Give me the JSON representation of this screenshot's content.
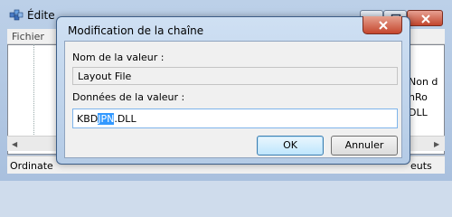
{
  "background_window": {
    "title": "Édite",
    "menu": [
      "Fichier"
    ],
    "right_column_lines": [
      "Non d",
      "nRo",
      "DLL"
    ],
    "status_left": "Ordinate",
    "status_right": "euts"
  },
  "dialog": {
    "title": "Modification de la chaîne",
    "value_name_label": "Nom de la valeur :",
    "value_name": "Layout File",
    "value_data_label": "Données de la valeur :",
    "value_data_before": "KBD",
    "value_data_selected": "JPN",
    "value_data_after": ".DLL",
    "ok_label": "OK",
    "cancel_label": "Annuler"
  },
  "colors": {
    "selection": "#3399ff",
    "close_button": "#c5472e",
    "dialog_frame": "#b4cbe6"
  },
  "icons": {
    "app": "registry-editor-icon",
    "close": "close-icon"
  }
}
